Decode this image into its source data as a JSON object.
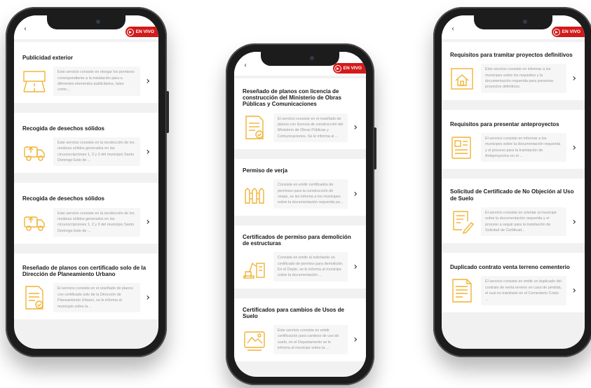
{
  "live_label": "EN VIVO",
  "back_mark": "‹",
  "colors": {
    "accent": "#f2b233",
    "live": "#d31a1a",
    "card": "#ffffff",
    "screen_bg": "#f1f1f1"
  },
  "phones": [
    {
      "cards": [
        {
          "title": "Publicidad exterior",
          "icon": "road-billboard-icon",
          "text": "Este servicio consiste en otorgar los permisos correspondiente a la instalación para a diferentes elementos publicitarios, tales como..."
        },
        {
          "title": "Recogida de desechos sólidos",
          "icon": "garbage-truck-icon",
          "text": "Este servicio consiste en la recolección de los residuos sólidos generados en las circunscripciones 1, 2 y 3 del municipio Santo Domingo Este de ..."
        },
        {
          "title": "Recogida de desechos sólidos",
          "icon": "garbage-truck-icon",
          "text": "Este servicio consiste en la recolección de los residuos sólidos generados en las circunscripciones 1, 2 y 3 del municipio Santo Domingo Este de ..."
        },
        {
          "title": "Reseñado de planos con certificado solo de la Dirección de Planeamiento Urbano",
          "icon": "document-check-icon",
          "text": "El servicio consiste en el reseñado de planos con certificado solo de la Dirección de Planeamiento Urbano, se le informa al municipio sobre la ..."
        }
      ]
    },
    {
      "cards": [
        {
          "title": "Reseñado de planos con licencia de construcción del Ministerio de Obras Públicas y Comunicaciones",
          "icon": "document-check-icon",
          "text": "El servicio consiste en el reseñado de planos con licencia de construcción del Ministerio de Obras Públicas y Comunicaciones. Se le informa al ..."
        },
        {
          "title": "Permiso de verja",
          "icon": "fence-icon",
          "text": "Consiste en emitir certificados de permisos para la construcción de verjas, se les informa a los municipes sobre la documentación requerida pa..."
        },
        {
          "title": "Certificados de permiso para demolición de estructuras",
          "icon": "excavator-building-icon",
          "text": "Consiste en emitir al solicitante un certificado de permiso para demolición. En el Depto. se le informa al municipe sobre la documentación ..."
        },
        {
          "title": "Certificados para cambios de Usos de Suelo",
          "icon": "land-certificate-icon",
          "text": "Este servicio consiste en emitir certificación para cambios de uso de suelo, en el Departamento se le informa al municipe sobre la ..."
        }
      ]
    },
    {
      "cards": [
        {
          "title": "Requisitos para tramitar proyectos definitivos",
          "icon": "house-blueprint-icon",
          "text": "Este servicio consiste en informar a los municipes sobre los requisitos y la documentación requerida para presentar proyectos definitivos."
        },
        {
          "title": "Requisitos para presentar anteproyectos",
          "icon": "blueprint-list-icon",
          "text": "El servicio consiste en informar a los municipes sobre la documentación requerida y el proceso para la tramitación de Anteproyectos en el ..."
        },
        {
          "title": "Solicitud de Certificado de No Objeción al Uso de Suelo",
          "icon": "certificate-pen-icon",
          "text": "El servicio consiste en orientar al municipe sobre la documentación requerida y el proceso a seguir para la tramitación de Solicitud de Certificad..."
        },
        {
          "title": "Duplicado contrato venta terreno cementerio",
          "icon": "contract-document-icon",
          "text": "El servicio consiste en emitir un duplicado del contrato de venta terreno en caso de pérdida, el cual es tramitado en el Cementerio Cristo ..."
        }
      ]
    }
  ]
}
